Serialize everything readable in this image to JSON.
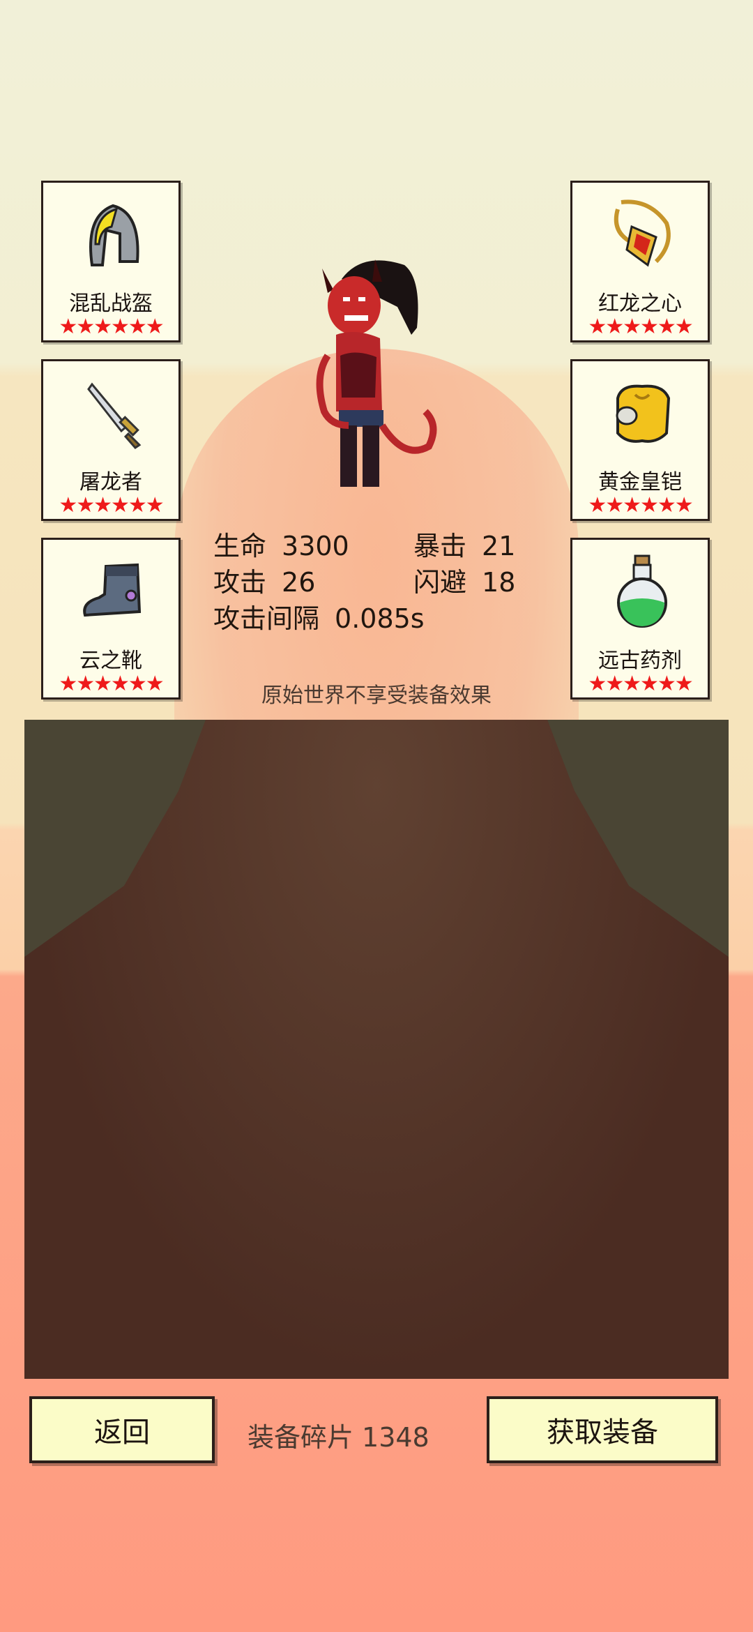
{
  "equipment_left": [
    {
      "name": "混乱战盔",
      "icon": "helmet-icon",
      "stars": "★★★★★★"
    },
    {
      "name": "屠龙者",
      "icon": "dagger-icon",
      "stars": "★★★★★★"
    },
    {
      "name": "云之靴",
      "icon": "boot-icon",
      "stars": "★★★★★★"
    }
  ],
  "equipment_right": [
    {
      "name": "红龙之心",
      "icon": "amulet-icon",
      "stars": "★★★★★★"
    },
    {
      "name": "黄金皇铠",
      "icon": "armor-icon",
      "stars": "★★★★★★"
    },
    {
      "name": "远古药剂",
      "icon": "potion-icon",
      "stars": "★★★★★★"
    }
  ],
  "stats": {
    "hp_label": "生命",
    "hp_value": "3300",
    "crit_label": "暴击",
    "crit_value": "21",
    "atk_label": "攻击",
    "atk_value": "26",
    "dodge_label": "闪避",
    "dodge_value": "18",
    "interval_label": "攻击间隔",
    "interval_value": "0.085s"
  },
  "notice": "原始世界不享受装备效果",
  "footer": {
    "back_label": "返回",
    "fragments_label": "装备碎片",
    "fragments_value": "1348",
    "get_equipment_label": "获取装备"
  },
  "colors": {
    "star": "#ee1a1a",
    "card_bg": "#fefde9",
    "button_bg": "#fbfcc8",
    "panel": "#4b2c22"
  }
}
